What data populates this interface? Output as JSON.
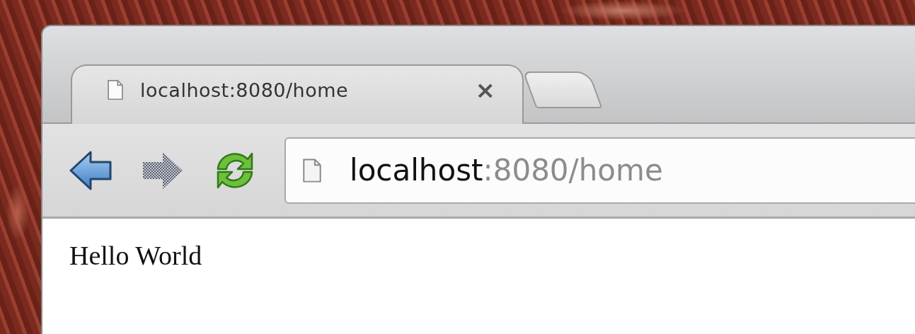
{
  "tabs": [
    {
      "title": "localhost:8080/home",
      "close": "×",
      "selected": true
    }
  ],
  "address": {
    "host": "localhost",
    "rest": ":8080/home"
  },
  "page": {
    "text": "Hello World"
  }
}
